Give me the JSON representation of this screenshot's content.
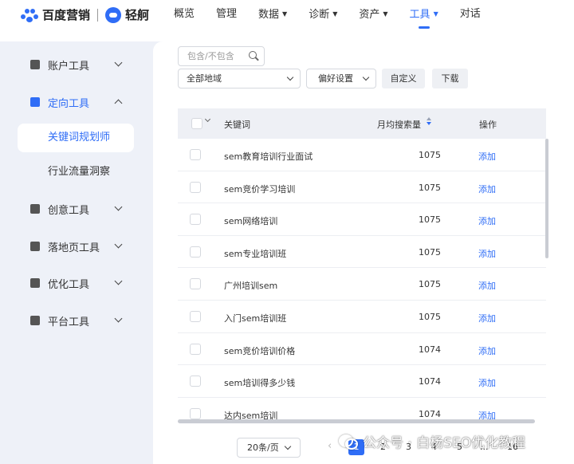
{
  "brand": {
    "name": "百度营销",
    "product": "轻舸"
  },
  "nav": [
    {
      "label": "概览",
      "dropdown": false
    },
    {
      "label": "管理",
      "dropdown": false
    },
    {
      "label": "数据",
      "dropdown": true
    },
    {
      "label": "诊断",
      "dropdown": true
    },
    {
      "label": "资产",
      "dropdown": true
    },
    {
      "label": "工具",
      "dropdown": true,
      "active": true
    },
    {
      "label": "对话",
      "dropdown": false
    }
  ],
  "sidebar": {
    "items": [
      {
        "label": "账户工具",
        "icon": "folder-icon",
        "expanded": false
      },
      {
        "label": "定向工具",
        "icon": "target-icon",
        "expanded": true
      },
      {
        "label": "创意工具",
        "icon": "image-icon",
        "expanded": false
      },
      {
        "label": "落地页工具",
        "icon": "page-icon",
        "expanded": false
      },
      {
        "label": "优化工具",
        "icon": "chart-icon",
        "expanded": false
      },
      {
        "label": "平台工具",
        "icon": "cube-icon",
        "expanded": false
      }
    ],
    "sub_items": [
      {
        "label": "关键词规划师",
        "active": true
      },
      {
        "label": "行业流量洞察",
        "active": false
      }
    ]
  },
  "toolbar": {
    "search_placeholder": "包含/不包含",
    "region_select": "全部地域",
    "preference_select": "偏好设置",
    "custom_button": "自定义",
    "download_button": "下载"
  },
  "table": {
    "headers": {
      "keyword": "关键词",
      "volume": "月均搜索量",
      "action": "操作"
    },
    "rows": [
      {
        "keyword": "sem教育培训行业面试",
        "volume": "1075",
        "action": "添加"
      },
      {
        "keyword": "sem竞价学习培训",
        "volume": "1075",
        "action": "添加"
      },
      {
        "keyword": "sem网络培训",
        "volume": "1075",
        "action": "添加"
      },
      {
        "keyword": "sem专业培训班",
        "volume": "1075",
        "action": "添加"
      },
      {
        "keyword": "广州培训sem",
        "volume": "1075",
        "action": "添加"
      },
      {
        "keyword": "入门sem培训班",
        "volume": "1075",
        "action": "添加"
      },
      {
        "keyword": "sem竞价培训价格",
        "volume": "1074",
        "action": "添加"
      },
      {
        "keyword": "sem培训得多少钱",
        "volume": "1074",
        "action": "添加"
      },
      {
        "keyword": "达内sem培训",
        "volume": "1074",
        "action": "添加"
      }
    ]
  },
  "pagination": {
    "page_size": "20条/页",
    "prev": "‹",
    "pages": [
      "1",
      "2",
      "3",
      "4",
      "5",
      "...",
      "16"
    ],
    "current": "1"
  },
  "watermark": "公众号 · 白杨SEO优化教程",
  "colors": {
    "accent": "#2f6df6",
    "background": "#eef1f8",
    "panel": "#ffffff"
  }
}
